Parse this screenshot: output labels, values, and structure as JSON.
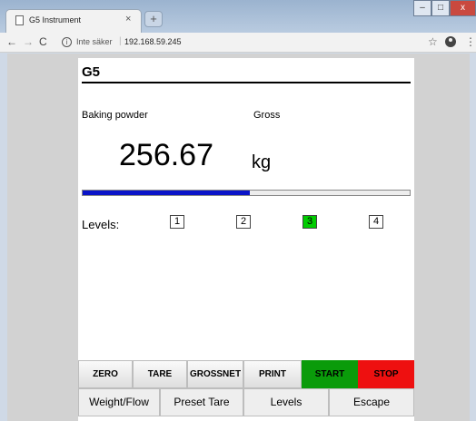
{
  "browser": {
    "tab_title": "G5 Instrument",
    "tab_close": "×",
    "new_tab": "+",
    "address_insecure": "Inte säker",
    "address_separator": "|",
    "address_url": "192.168.59.245",
    "nav_back": "←",
    "nav_forward": "→",
    "nav_reload": "C",
    "info_glyph": "i",
    "star": "☆",
    "menu": "⋮",
    "window_controls": {
      "minimize": "–",
      "maximize": "□",
      "close": "x"
    }
  },
  "instrument": {
    "title": "G5",
    "product": "Baking powder",
    "mode": "Gross",
    "weight_value": "256.67",
    "weight_unit": "kg",
    "progress_fraction": 0.51,
    "levels_label": "Levels:",
    "levels": [
      {
        "label": "1",
        "active": false
      },
      {
        "label": "2",
        "active": false
      },
      {
        "label": "3",
        "active": true
      },
      {
        "label": "4",
        "active": false
      }
    ],
    "colors": {
      "bar": "#0a14c8",
      "level_active": "#00cc00",
      "start": "#0a9b0a",
      "stop": "#ee1010"
    }
  },
  "command_buttons": [
    "ZERO",
    "TARE",
    "GROSSNET",
    "PRINT",
    "START",
    "STOP"
  ],
  "function_buttons": [
    "Weight/Flow",
    "Preset Tare",
    "Levels",
    "Escape"
  ]
}
